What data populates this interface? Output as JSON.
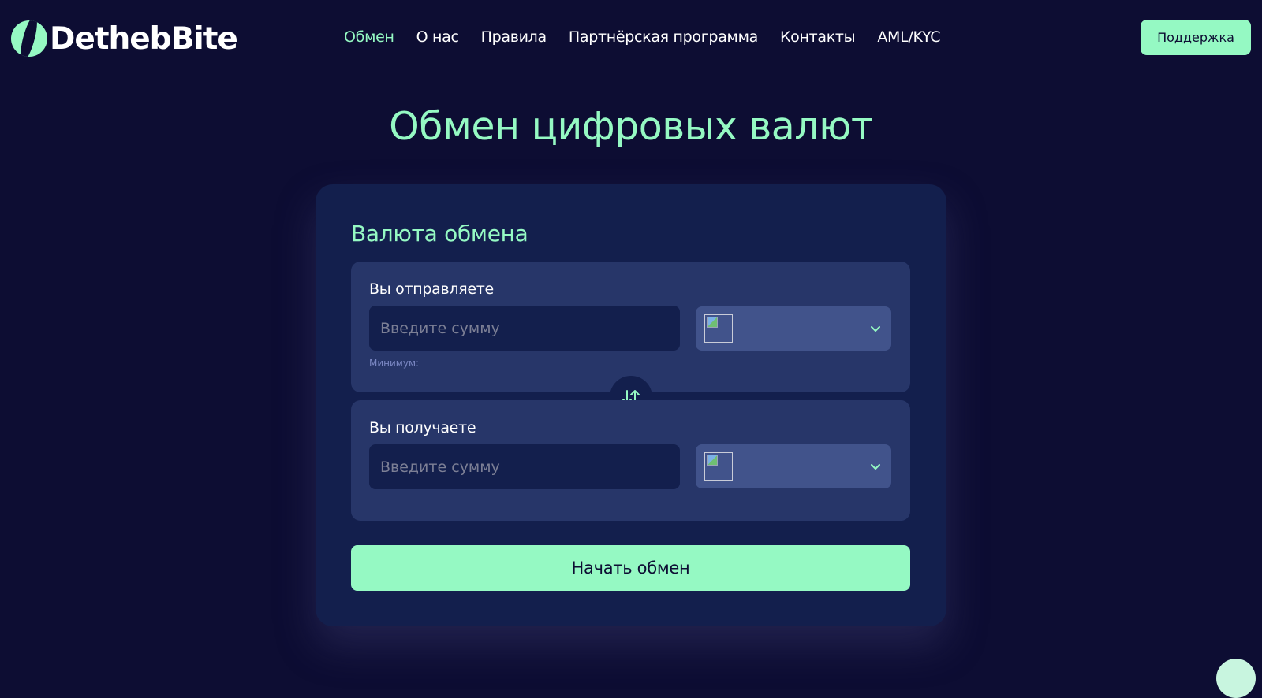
{
  "brand": {
    "name": "DethebBite",
    "accent": "#95f9c3",
    "background": "#0d0d33"
  },
  "nav": {
    "items": [
      {
        "label": "Обмен",
        "active": true
      },
      {
        "label": "О нас",
        "active": false
      },
      {
        "label": "Правила",
        "active": false
      },
      {
        "label": "Партнёрская программа",
        "active": false
      },
      {
        "label": "Контакты",
        "active": false
      },
      {
        "label": "AML/KYC",
        "active": false
      }
    ],
    "support_label": "Поддержка"
  },
  "hero": {
    "title": "Обмен цифровых валют"
  },
  "exchange": {
    "title": "Валюта обмена",
    "send": {
      "label": "Вы отправляете",
      "amount_placeholder": "Введите сумму",
      "amount_value": "",
      "min_label": "Минимум:",
      "currency_icon": "broken-image-icon"
    },
    "receive": {
      "label": "Вы получаете",
      "amount_placeholder": "Введите сумму",
      "amount_value": "",
      "currency_icon": "broken-image-icon"
    },
    "swap_icon": "swap-arrows-icon",
    "submit_label": "Начать обмен"
  }
}
